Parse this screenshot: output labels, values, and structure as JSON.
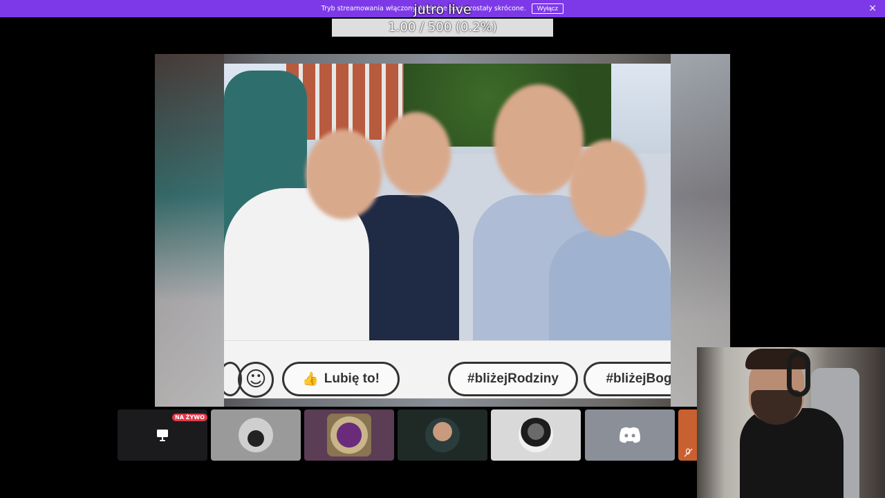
{
  "banner": {
    "message": "Tryb streamowania włączony. Niektóre opcje zostały skrócone.",
    "off_button": "Wyłącz",
    "close_glyph": "×"
  },
  "stream": {
    "title": "jutro live",
    "counter": "1.00 / 500 (0.2%)"
  },
  "board": {
    "like_label": "Lubię to!",
    "tag1": "#bliżejRodziny",
    "tag2": "#bliżejBog"
  },
  "participants": {
    "live_badge": "NA ŻYWO",
    "tiles": [
      {
        "name": "screen-share-tile",
        "bg": "#1b1b1d",
        "icon": "monitor-icon"
      },
      {
        "name": "car-avatar-tile",
        "bg": "#9a9a9a",
        "icon": "car-avatar"
      },
      {
        "name": "framed-avatar-tile",
        "bg": "#5b3d55",
        "icon": "framed-avatar"
      },
      {
        "name": "glasses-avatar-tile",
        "bg": "#1f2a26",
        "icon": "person-avatar"
      },
      {
        "name": "bw-avatar-tile",
        "bg": "#d9d9d9",
        "icon": "person-avatar"
      },
      {
        "name": "discord-avatar-tile",
        "bg": "#8b8f98",
        "icon": "discord-icon"
      },
      {
        "name": "orange-avatar-tile",
        "bg": "#c9602f",
        "icon": "mic-off-icon"
      }
    ]
  }
}
